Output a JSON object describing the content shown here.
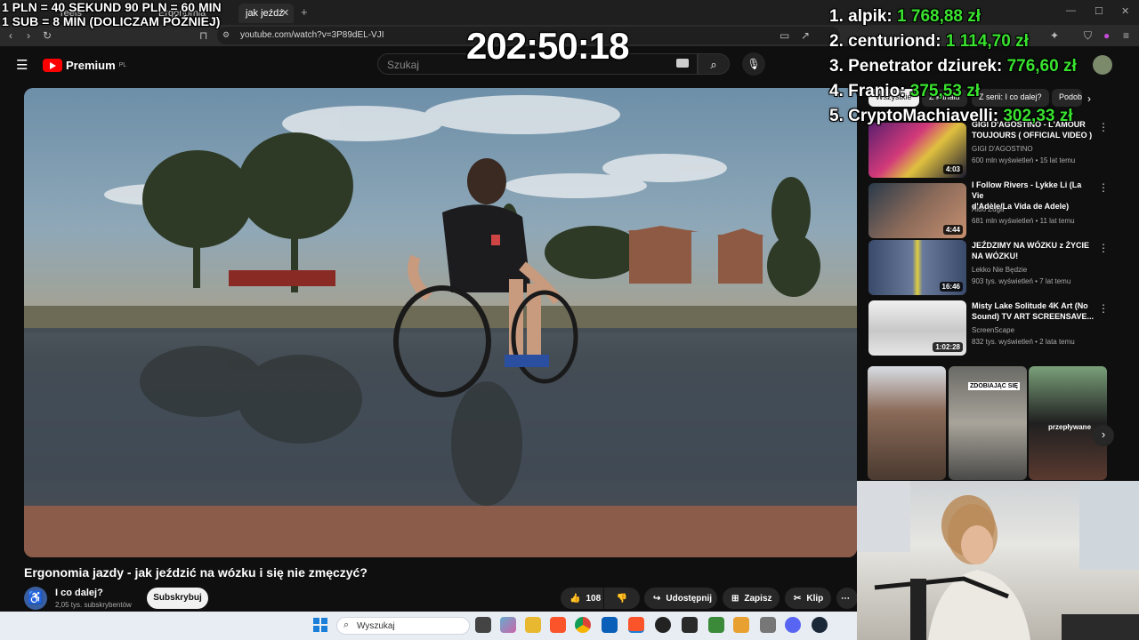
{
  "browser": {
    "tabs": [
      "reels",
      "Ergonomia",
      "jak jeźdź"
    ],
    "url": "youtube.com/watch?v=3P89dEL-VJI"
  },
  "youtube": {
    "logo": "Premium",
    "logo_region": "PL",
    "search_placeholder": "Szukaj"
  },
  "video": {
    "title": "Ergonomia jazdy - jak jeździć na wózku i się nie zmęczyć?",
    "channel": "I co dalej?",
    "subscribers": "2,05 tys. subskrybentów",
    "subscribe_label": "Subskrybuj",
    "likes": "108",
    "share_label": "Udostępnij",
    "save_label": "Zapisz",
    "clip_label": "Klip"
  },
  "sidebar": {
    "chips": [
      "Wszystkie",
      "Z kanału",
      "Z serii: I co dalej?",
      "Podobne"
    ],
    "recommendations": [
      {
        "title_line1": "GIGI D'AGOSTINO - L'AMOUR",
        "title_line2": "TOUJOURS ( OFFICIAL VIDEO )",
        "channel": "GIGI D'AGOSTINO",
        "meta": "600 mln wyświetleń • 15 lat temu",
        "duration": "4:03"
      },
      {
        "title_line1": "I Follow Rivers - Lykke Li (La Vie",
        "title_line2": "d'Adèle/La Vida de Adele)",
        "channel": "Aido Zuga",
        "meta": "681 mln wyświetleń • 11 lat temu",
        "duration": "4:44"
      },
      {
        "title_line1": "JEŹDZIMY NA WÓZKU z ŻYCIE",
        "title_line2": "NA WÓZKU!",
        "channel": "Lekko Nie Będzie",
        "meta": "903 tys. wyświetleń • 7 lat temu",
        "duration": "16:46"
      },
      {
        "title_line1": "Misty Lake Solitude 4K Art (No",
        "title_line2": "Sound) TV ART SCREENSAVE...",
        "channel": "ScreenScape",
        "meta": "832 tys. wyświetleń • 2 lata temu",
        "duration": "1:02:28"
      }
    ],
    "shorts_captions": [
      "ZDOBIAJĄC SIĘ",
      "przepływane"
    ]
  },
  "taskbar": {
    "search_placeholder": "Wyszukaj"
  },
  "overlay": {
    "donate_line1": "1 PLN =  40 SEKUND 90 PLN = 60 MIN",
    "donate_line2": "1 SUB = 8 MIN (DOLICZAM PÓŹNIEJ)",
    "timer": "202:50:18",
    "leaderboard": [
      {
        "rank_name": "1. alpik:",
        "amount": "1 768,88 zł"
      },
      {
        "rank_name": "2. centuriond:",
        "amount": "1 114,70 zł"
      },
      {
        "rank_name": "3. Penetrator dziurek:",
        "amount": "776,60 zł"
      },
      {
        "rank_name": "4. Franio:",
        "amount": "375,53 zł"
      },
      {
        "rank_name": "5. CryptoMachiavelli:",
        "amount": "302,33 zł"
      }
    ]
  },
  "colors": {
    "accent_red": "#ff0000",
    "leaderboard_amount": "#39e22f",
    "background": "#0f0f0f"
  }
}
